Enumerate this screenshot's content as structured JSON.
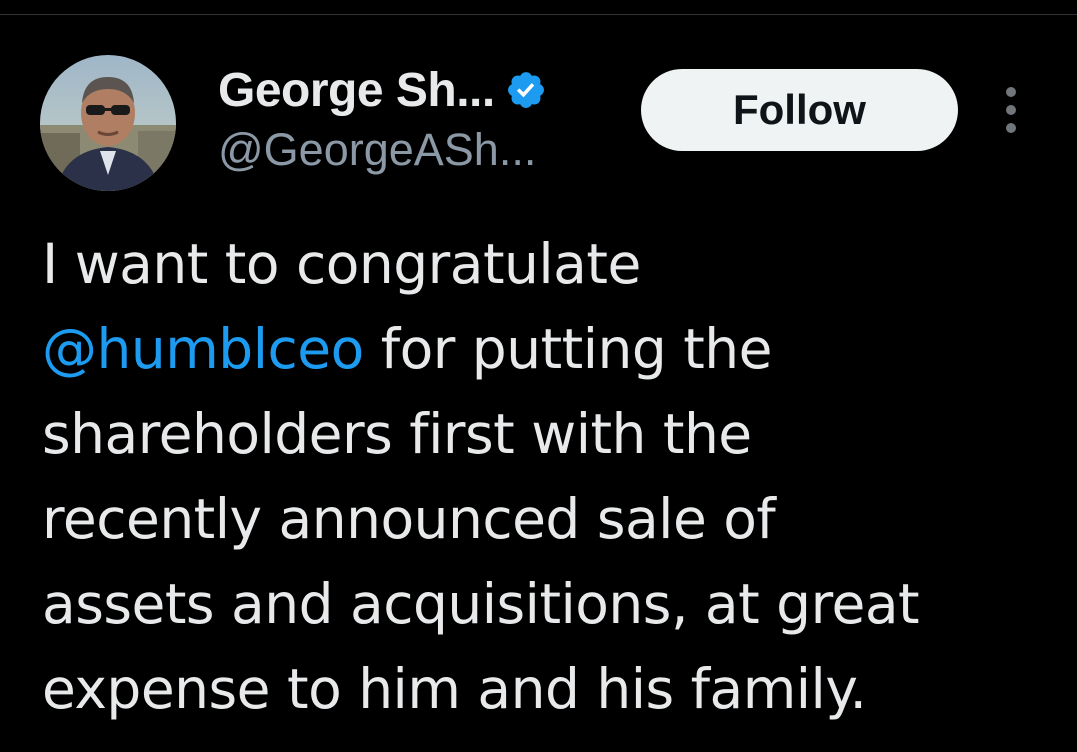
{
  "author": {
    "display_name": "George Sh...",
    "handle": "@GeorgeASh...",
    "verified": true,
    "avatar": "profile-photo"
  },
  "actions": {
    "follow_label": "Follow",
    "more_icon": "vertical-ellipsis-icon"
  },
  "tweet": {
    "line1": "I want to congratulate",
    "mention": "@humblceo",
    "line2_rest": " for putting the",
    "line3": "shareholders first with the",
    "line4": "recently announced sale of",
    "line5": "assets and acquisitions, at great",
    "line6": "expense to him and his family."
  },
  "colors": {
    "background": "#000000",
    "text": "#e7e9ea",
    "secondary_text": "#8b98a5",
    "link": "#1d9bf0",
    "verified_badge": "#1d9bf0",
    "follow_button_bg": "#eff3f4",
    "follow_button_text": "#0f1419"
  }
}
